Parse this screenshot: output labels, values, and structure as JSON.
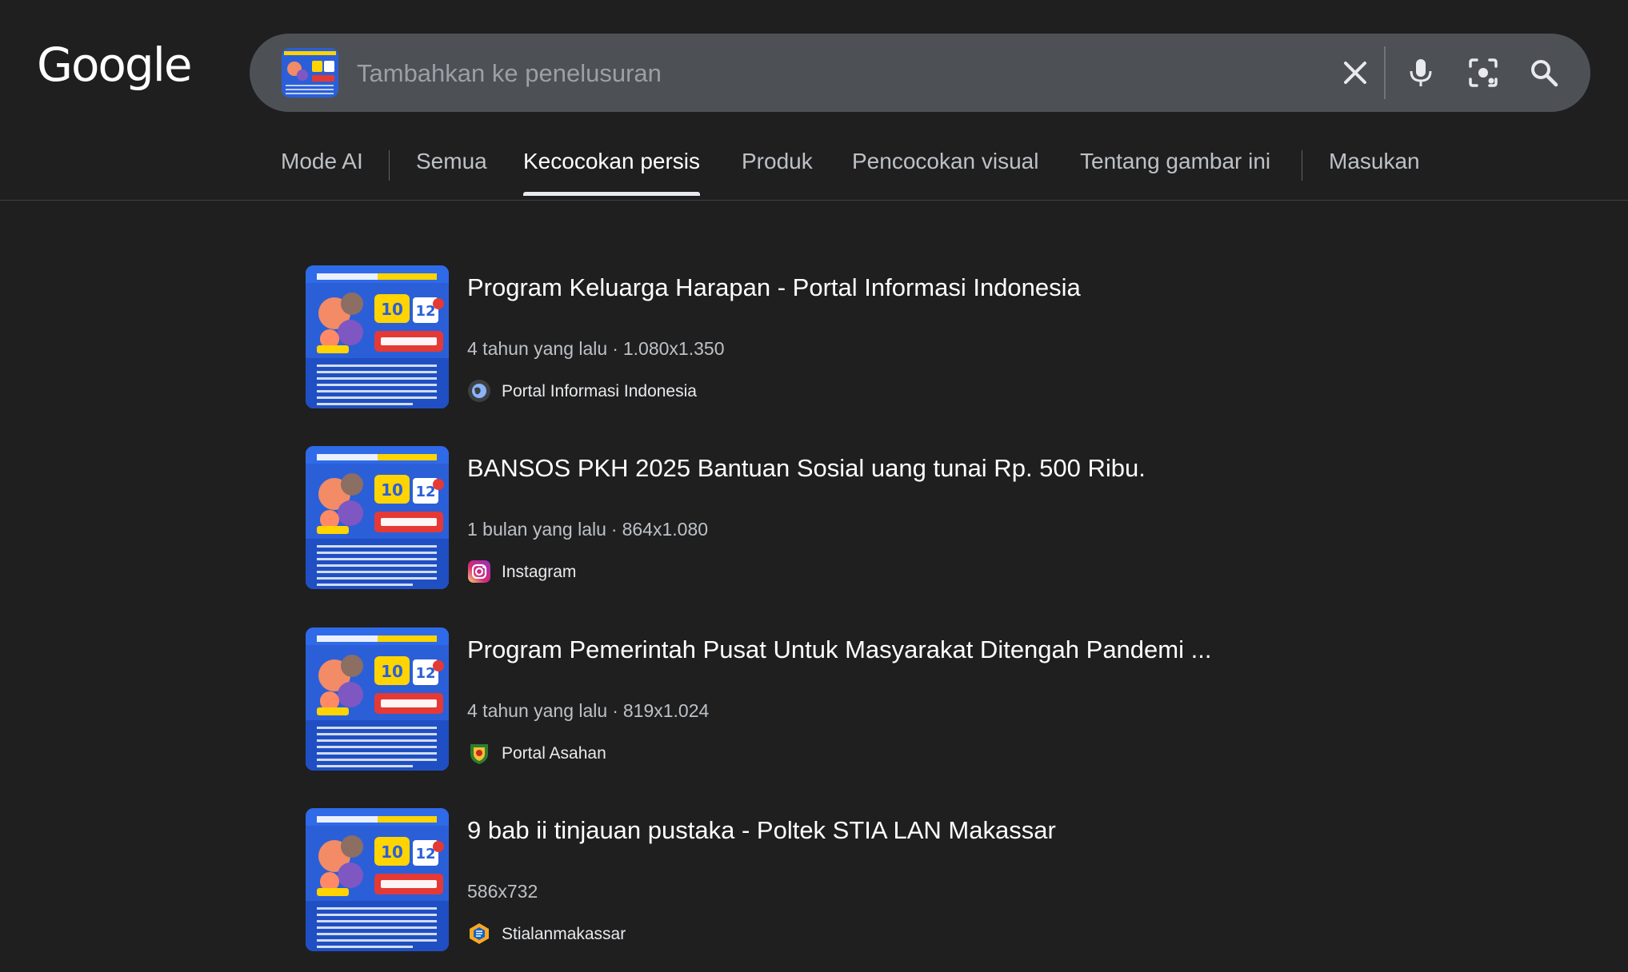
{
  "header": {
    "logo": "Google",
    "search": {
      "placeholder": "Tambahkan ke penelusuran",
      "value": ""
    }
  },
  "tabs": [
    {
      "label": "Mode AI"
    },
    {
      "label": "Semua"
    },
    {
      "label": "Kecocokan persis",
      "active": true
    },
    {
      "label": "Produk"
    },
    {
      "label": "Pencocokan visual"
    },
    {
      "label": "Tentang gambar ini"
    },
    {
      "label": "Masukan"
    }
  ],
  "results": [
    {
      "title": "Program Keluarga Harapan - Portal Informasi Indonesia",
      "age": "4 tahun yang lalu",
      "dims": "1.080x1.350",
      "source": "Portal Informasi Indonesia",
      "favicon": "globe-icon"
    },
    {
      "title": "BANSOS PKH 2025 Bantuan Sosial uang tunai Rp. 500 Ribu.",
      "age": "1 bulan yang lalu",
      "dims": "864x1.080",
      "source": "Instagram",
      "favicon": "instagram-icon"
    },
    {
      "title": "Program Pemerintah Pusat Untuk Masyarakat Ditengah Pandemi ...",
      "age": "4 tahun yang lalu",
      "dims": "819x1.024",
      "source": "Portal Asahan",
      "favicon": "crest-icon"
    },
    {
      "title": "9 bab ii tinjauan pustaka - Poltek STIA LAN Makassar",
      "age": "",
      "dims": "586x732",
      "source": "Stialanmakassar",
      "favicon": "hexagon-logo-icon"
    }
  ],
  "colors": {
    "background": "#1f1f1f",
    "searchbar": "#4d5156",
    "poster_blue": "#2b5fd8",
    "poster_yellow": "#ffd400",
    "poster_red": "#e53935"
  }
}
